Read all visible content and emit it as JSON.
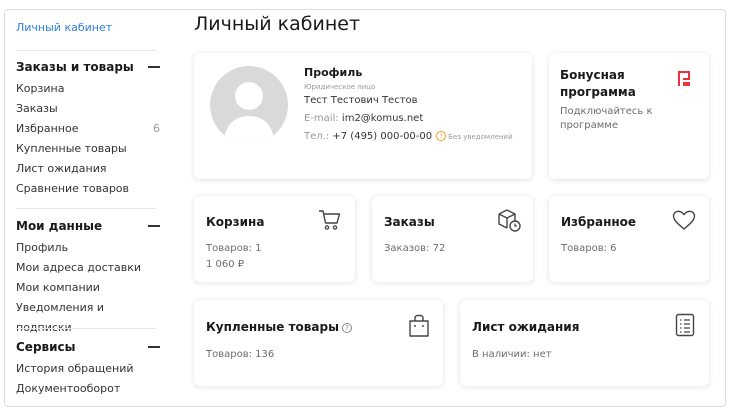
{
  "sidebar": {
    "top_link": "Личный кабинет",
    "groups": [
      {
        "title": "Заказы и товары",
        "items": [
          {
            "label": "Корзина",
            "count": ""
          },
          {
            "label": "Заказы",
            "count": ""
          },
          {
            "label": "Избранное",
            "count": "6"
          },
          {
            "label": "Купленные товары",
            "count": ""
          },
          {
            "label": "Лист ожидания",
            "count": ""
          },
          {
            "label": "Сравнение товаров",
            "count": ""
          }
        ]
      },
      {
        "title": "Мои данные",
        "items": [
          {
            "label": "Профиль"
          },
          {
            "label": "Мои адреса доставки"
          },
          {
            "label": "Мои компании"
          },
          {
            "label": "Уведомления и подписки"
          }
        ]
      },
      {
        "title": "Сервисы",
        "items": [
          {
            "label": "История обращений"
          },
          {
            "label": "Документооборот"
          }
        ]
      }
    ]
  },
  "main": {
    "title": "Личный кабинет",
    "profile": {
      "title": "Профиль",
      "type": "Юридическое лицо",
      "full_name": "Тест Тестович Тестов",
      "email_label": "E-mail:",
      "email": "im2@komus.net",
      "phone_label": "Тел.:",
      "phone": "+7 (495) 000-00-00",
      "notifications": "Без уведомлений"
    },
    "bonus": {
      "title": "Бонусная программа",
      "text": "Подключайтесь к программе"
    },
    "cart": {
      "title": "Корзина",
      "line1": "Товаров: 1",
      "line2": "1 060 ₽"
    },
    "orders": {
      "title": "Заказы",
      "line1": "Заказов: 72"
    },
    "favorites": {
      "title": "Избранное",
      "line1": "Товаров: 6"
    },
    "purchased": {
      "title": "Купленные товары",
      "line1": "Товаров: 136"
    },
    "waitlist": {
      "title": "Лист ожидания",
      "line1": "В наличии: нет"
    }
  },
  "colors": {
    "link": "#2f7fd9",
    "bonus_icon": "#e8343c",
    "warning": "#f0a020"
  }
}
